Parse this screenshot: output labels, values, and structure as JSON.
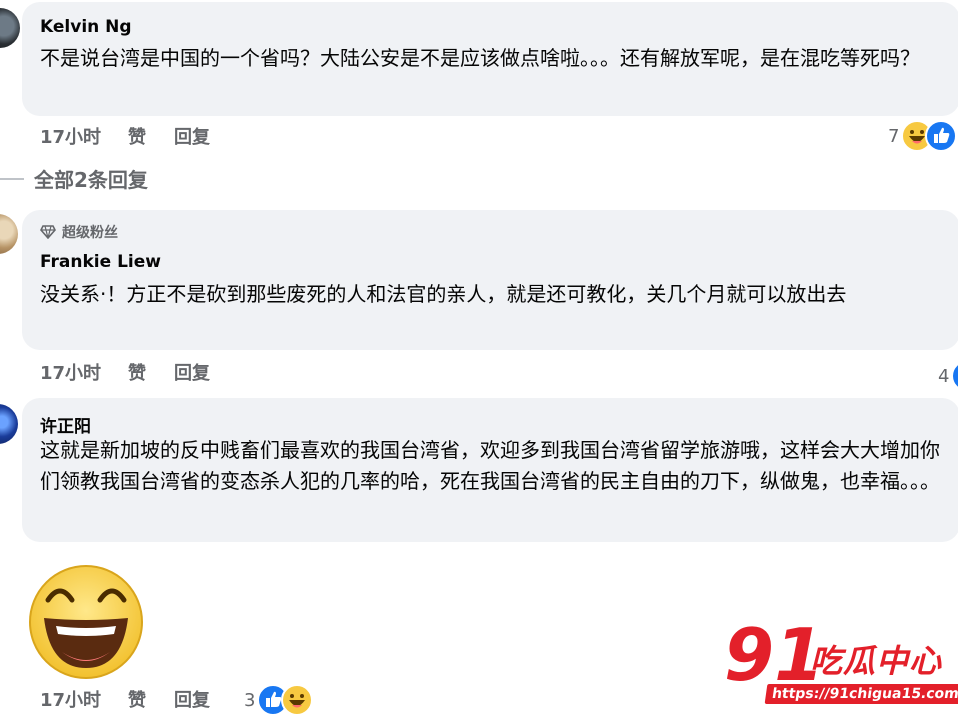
{
  "comments": [
    {
      "author": "Kelvin Ng",
      "text": "不是说台湾是中国的一个省吗？大陆公安是不是应该做点啥啦。。。还有解放军呢，是在混吃等死吗？",
      "time": "17小时",
      "like_label": "赞",
      "reply_label": "回复",
      "reaction_count": "7",
      "reaction_icons": [
        "haha-icon",
        "like-icon"
      ]
    },
    {
      "badge": "超级粉丝",
      "author": "Frankie Liew",
      "text": "没关系·！方正不是砍到那些废死的人和法官的亲人，就是还可教化，关几个月就可以放出去",
      "time": "17小时",
      "like_label": "赞",
      "reply_label": "回复",
      "reaction_count": "4",
      "reaction_icons": [
        "like-icon"
      ]
    },
    {
      "author": "许正阳",
      "text": "这就是新加坡的反中贱畜们最喜欢的我国台湾省，欢迎多到我国台湾省留学旅游哦，这样会大大增加你们领教我国台湾省的变态杀人犯的几率的哈，死在我国台湾省的民主自由的刀下，纵做鬼，也幸福。。。",
      "time": "17小时",
      "like_label": "赞",
      "reply_label": "回复",
      "reaction_count": "3",
      "reaction_icons": [
        "like-icon",
        "haha-icon"
      ],
      "sticker": "laughing-face-sticker"
    }
  ],
  "view_replies_label": "全部2条回复",
  "watermark": {
    "logo_number": "91",
    "name": "吃瓜中心",
    "url": "https://91chigua15.com"
  },
  "colors": {
    "bubble": "#f0f2f5",
    "meta_text": "#65676b",
    "like_blue": "#1877f2",
    "haha_yellow": "#f7c941",
    "watermark_red": "#e3202a"
  }
}
